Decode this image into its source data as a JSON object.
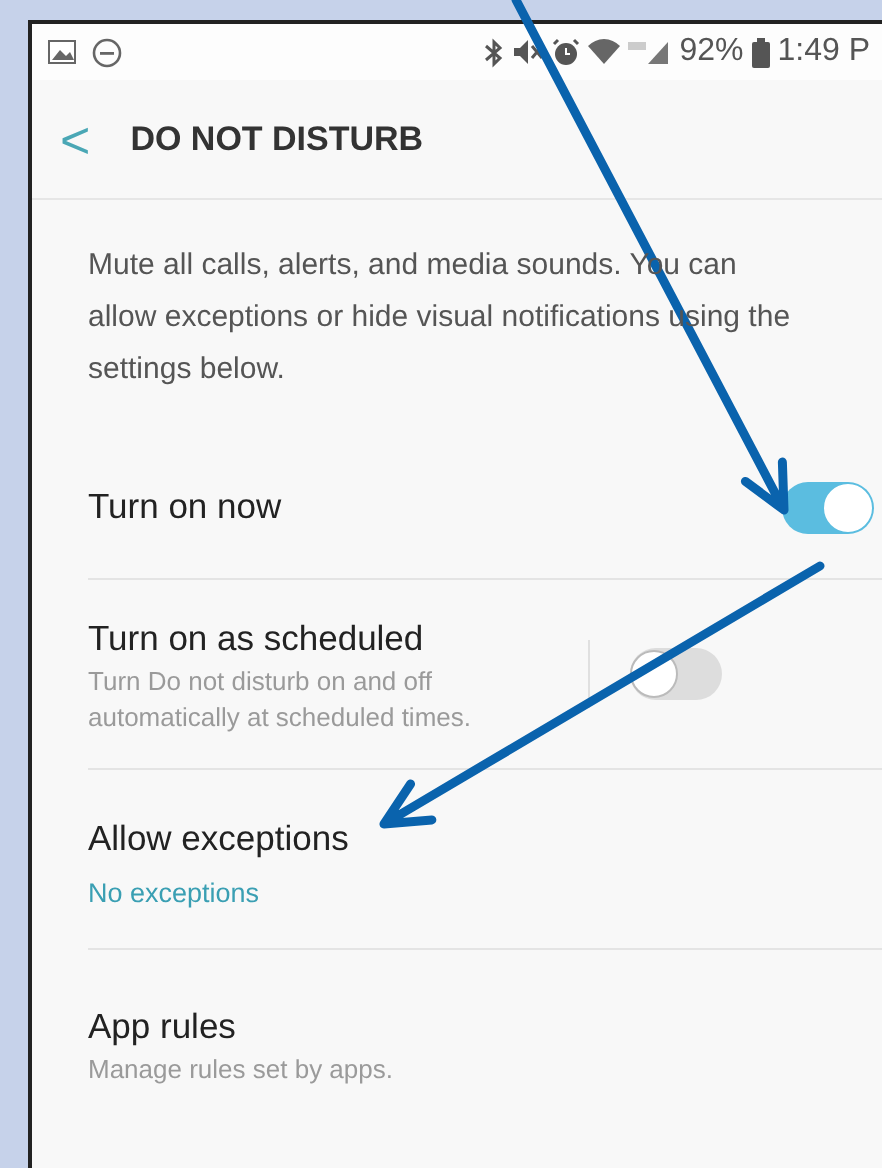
{
  "status_bar": {
    "battery_text": "92%",
    "time": "1:49 P"
  },
  "header": {
    "back": "<",
    "title": "DO NOT DISTURB"
  },
  "description": "Mute all calls, alerts, and media sounds. You can allow exceptions or hide visual notifications using the settings below.",
  "settings": [
    {
      "kind": "switch",
      "title": "Turn on now",
      "on": true,
      "divided": false
    },
    {
      "kind": "switch",
      "title": "Turn on as scheduled",
      "subtitle": "Turn Do not disturb on and off automatically at scheduled times.",
      "on": false,
      "divided": true
    },
    {
      "kind": "link",
      "title": "Allow exceptions",
      "value": "No exceptions"
    },
    {
      "kind": "link",
      "title": "App rules",
      "subtitle": "Manage rules set by apps."
    }
  ],
  "annotations": [
    {
      "kind": "arrow"
    },
    {
      "kind": "arrow"
    }
  ]
}
